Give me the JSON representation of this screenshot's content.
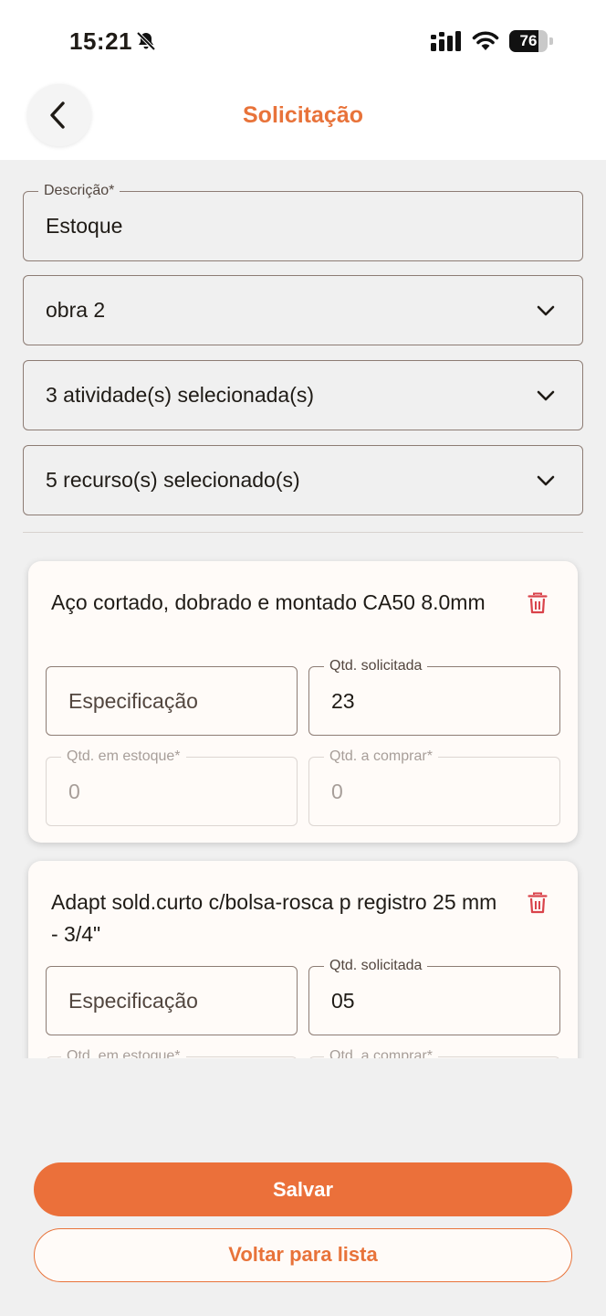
{
  "status_bar": {
    "time": "15:21",
    "battery": "76",
    "battery_level": 0.76
  },
  "header": {
    "title": "Solicitação"
  },
  "form": {
    "descricao": {
      "label": "Descrição*",
      "value": "Estoque"
    },
    "obra": {
      "value": "obra 2"
    },
    "atividades": {
      "value": "3 atividade(s) selecionada(s)"
    },
    "recursos": {
      "value": "5 recurso(s) selecionado(s)"
    }
  },
  "items": [
    {
      "title": "Aço cortado, dobrado e montado CA50 8.0mm",
      "especificacao_placeholder": "Especificação",
      "qtd_solicitada_label": "Qtd. solicitada",
      "qtd_solicitada": "23",
      "qtd_estoque_label": "Qtd. em estoque*",
      "qtd_estoque": "0",
      "qtd_comprar_label": "Qtd. a comprar*",
      "qtd_comprar": "0"
    },
    {
      "title": "Adapt sold.curto c/bolsa-rosca p registro 25 mm - 3/4\"",
      "especificacao_placeholder": "Especificação",
      "qtd_solicitada_label": "Qtd. solicitada",
      "qtd_solicitada": "05",
      "qtd_estoque_label": "Qtd. em estoque*",
      "qtd_comprar_label": "Qtd. a comprar*"
    }
  ],
  "actions": {
    "save": "Salvar",
    "back_to_list": "Voltar para lista"
  },
  "colors": {
    "accent": "#eb703a",
    "delete": "#d9434b",
    "background": "#f0f0f0"
  },
  "icons": [
    "bell-slash-icon",
    "cellular-signal-icon",
    "wifi-icon",
    "battery-icon",
    "chevron-left-icon",
    "chevron-down-icon",
    "trash-icon"
  ]
}
